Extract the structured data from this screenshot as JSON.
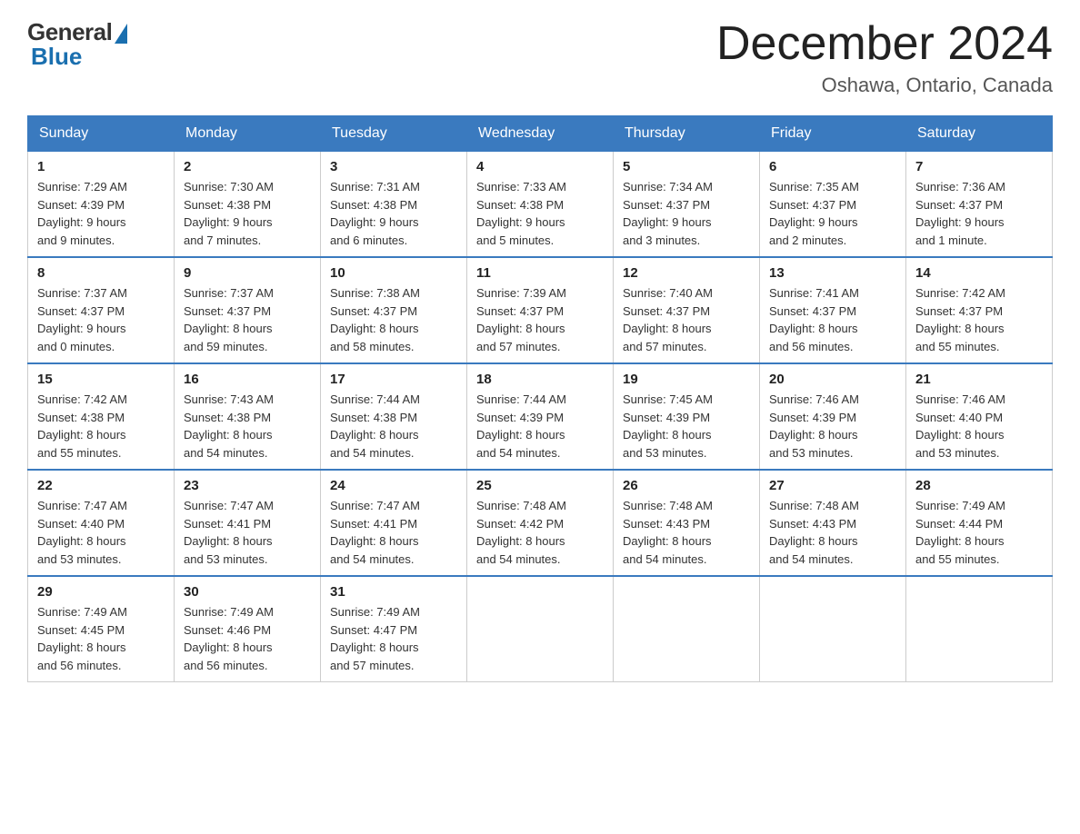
{
  "logo": {
    "general": "General",
    "blue": "Blue"
  },
  "header": {
    "month": "December 2024",
    "location": "Oshawa, Ontario, Canada"
  },
  "days_of_week": [
    "Sunday",
    "Monday",
    "Tuesday",
    "Wednesday",
    "Thursday",
    "Friday",
    "Saturday"
  ],
  "weeks": [
    [
      {
        "num": "1",
        "sunrise": "7:29 AM",
        "sunset": "4:39 PM",
        "daylight": "9 hours and 9 minutes."
      },
      {
        "num": "2",
        "sunrise": "7:30 AM",
        "sunset": "4:38 PM",
        "daylight": "9 hours and 7 minutes."
      },
      {
        "num": "3",
        "sunrise": "7:31 AM",
        "sunset": "4:38 PM",
        "daylight": "9 hours and 6 minutes."
      },
      {
        "num": "4",
        "sunrise": "7:33 AM",
        "sunset": "4:38 PM",
        "daylight": "9 hours and 5 minutes."
      },
      {
        "num": "5",
        "sunrise": "7:34 AM",
        "sunset": "4:37 PM",
        "daylight": "9 hours and 3 minutes."
      },
      {
        "num": "6",
        "sunrise": "7:35 AM",
        "sunset": "4:37 PM",
        "daylight": "9 hours and 2 minutes."
      },
      {
        "num": "7",
        "sunrise": "7:36 AM",
        "sunset": "4:37 PM",
        "daylight": "9 hours and 1 minute."
      }
    ],
    [
      {
        "num": "8",
        "sunrise": "7:37 AM",
        "sunset": "4:37 PM",
        "daylight": "9 hours and 0 minutes."
      },
      {
        "num": "9",
        "sunrise": "7:37 AM",
        "sunset": "4:37 PM",
        "daylight": "8 hours and 59 minutes."
      },
      {
        "num": "10",
        "sunrise": "7:38 AM",
        "sunset": "4:37 PM",
        "daylight": "8 hours and 58 minutes."
      },
      {
        "num": "11",
        "sunrise": "7:39 AM",
        "sunset": "4:37 PM",
        "daylight": "8 hours and 57 minutes."
      },
      {
        "num": "12",
        "sunrise": "7:40 AM",
        "sunset": "4:37 PM",
        "daylight": "8 hours and 57 minutes."
      },
      {
        "num": "13",
        "sunrise": "7:41 AM",
        "sunset": "4:37 PM",
        "daylight": "8 hours and 56 minutes."
      },
      {
        "num": "14",
        "sunrise": "7:42 AM",
        "sunset": "4:37 PM",
        "daylight": "8 hours and 55 minutes."
      }
    ],
    [
      {
        "num": "15",
        "sunrise": "7:42 AM",
        "sunset": "4:38 PM",
        "daylight": "8 hours and 55 minutes."
      },
      {
        "num": "16",
        "sunrise": "7:43 AM",
        "sunset": "4:38 PM",
        "daylight": "8 hours and 54 minutes."
      },
      {
        "num": "17",
        "sunrise": "7:44 AM",
        "sunset": "4:38 PM",
        "daylight": "8 hours and 54 minutes."
      },
      {
        "num": "18",
        "sunrise": "7:44 AM",
        "sunset": "4:39 PM",
        "daylight": "8 hours and 54 minutes."
      },
      {
        "num": "19",
        "sunrise": "7:45 AM",
        "sunset": "4:39 PM",
        "daylight": "8 hours and 53 minutes."
      },
      {
        "num": "20",
        "sunrise": "7:46 AM",
        "sunset": "4:39 PM",
        "daylight": "8 hours and 53 minutes."
      },
      {
        "num": "21",
        "sunrise": "7:46 AM",
        "sunset": "4:40 PM",
        "daylight": "8 hours and 53 minutes."
      }
    ],
    [
      {
        "num": "22",
        "sunrise": "7:47 AM",
        "sunset": "4:40 PM",
        "daylight": "8 hours and 53 minutes."
      },
      {
        "num": "23",
        "sunrise": "7:47 AM",
        "sunset": "4:41 PM",
        "daylight": "8 hours and 53 minutes."
      },
      {
        "num": "24",
        "sunrise": "7:47 AM",
        "sunset": "4:41 PM",
        "daylight": "8 hours and 54 minutes."
      },
      {
        "num": "25",
        "sunrise": "7:48 AM",
        "sunset": "4:42 PM",
        "daylight": "8 hours and 54 minutes."
      },
      {
        "num": "26",
        "sunrise": "7:48 AM",
        "sunset": "4:43 PM",
        "daylight": "8 hours and 54 minutes."
      },
      {
        "num": "27",
        "sunrise": "7:48 AM",
        "sunset": "4:43 PM",
        "daylight": "8 hours and 54 minutes."
      },
      {
        "num": "28",
        "sunrise": "7:49 AM",
        "sunset": "4:44 PM",
        "daylight": "8 hours and 55 minutes."
      }
    ],
    [
      {
        "num": "29",
        "sunrise": "7:49 AM",
        "sunset": "4:45 PM",
        "daylight": "8 hours and 56 minutes."
      },
      {
        "num": "30",
        "sunrise": "7:49 AM",
        "sunset": "4:46 PM",
        "daylight": "8 hours and 56 minutes."
      },
      {
        "num": "31",
        "sunrise": "7:49 AM",
        "sunset": "4:47 PM",
        "daylight": "8 hours and 57 minutes."
      },
      null,
      null,
      null,
      null
    ]
  ],
  "labels": {
    "sunrise": "Sunrise:",
    "sunset": "Sunset:",
    "daylight": "Daylight:"
  }
}
